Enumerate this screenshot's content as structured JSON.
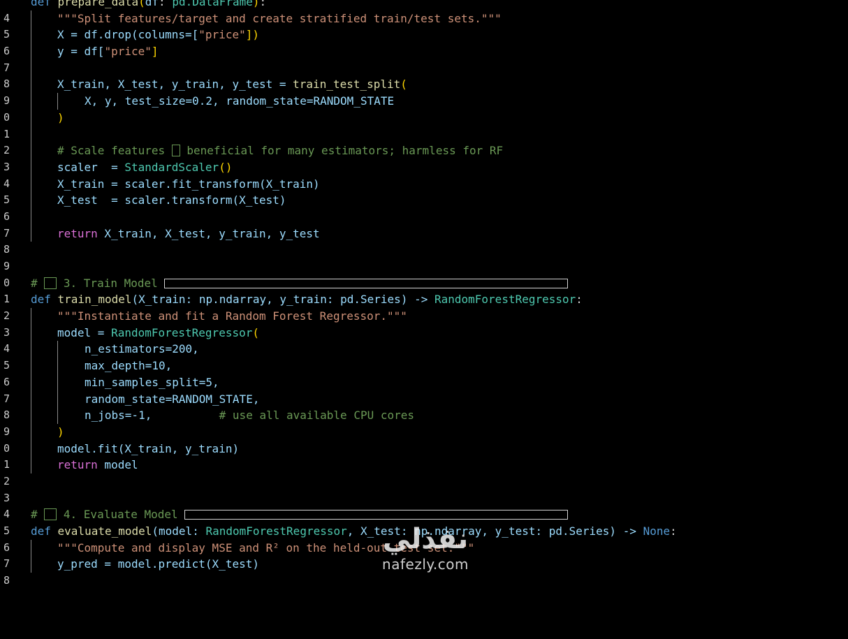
{
  "editor": {
    "line_numbers": [
      "4",
      "5",
      "6",
      "7",
      "8",
      "9",
      "0",
      "1",
      "2",
      "3",
      "4",
      "5",
      "6",
      "7",
      "8",
      "9",
      "0",
      "1",
      "2",
      "3",
      "4",
      "5",
      "6",
      "7",
      "8",
      "9",
      "0",
      "1",
      "2",
      "3",
      "4",
      "5",
      "6",
      "7",
      "8"
    ],
    "colors": {
      "background": "#000000",
      "keyword": "#569cd6",
      "function": "#dcdcaa",
      "string": "#ce9178",
      "comment": "#6a9955",
      "type": "#4ec9b0",
      "variable": "#9cdcfe",
      "number": "#b5cea8"
    },
    "code": {
      "l34": "def prepare_data(df: pd.DataFrame):",
      "l35": "\"\"\"Split features/target and create stratified train/test sets.\"\"\"",
      "l36_a": "X = df.drop(columns=[",
      "l36_b": "\"price\"",
      "l36_c": "])",
      "l37_a": "y = df[",
      "l37_b": "\"price\"",
      "l37_c": "]",
      "l39_a": "X_train, X_test, y_train, y_test = ",
      "l39_b": "train_test_split",
      "l39_c": "(",
      "l40": "X, y, test_size=0.2, random_state=RANDOM_STATE",
      "l41": ")",
      "l43_a": "# Scale features ",
      "l43_b": " beneficial for many estimators; harmless for RF",
      "l44_a": "scaler  = ",
      "l44_b": "StandardScaler",
      "l44_c": "()",
      "l45": "X_train = scaler.fit_transform(X_train)",
      "l46": "X_test  = scaler.transform(X_test)",
      "l48_a": "return",
      "l48_b": " X_train, X_test, y_train, y_test",
      "l51_a": "# ",
      "l51_b": " 3. Train Model ",
      "l52_a": "def ",
      "l52_b": "train_model",
      "l52_c": "(X_train: np.ndarray, y_train: pd.Series) -> ",
      "l52_d": "RandomForestRegressor",
      "l52_e": ":",
      "l53": "\"\"\"Instantiate and fit a Random Forest Regressor.\"\"\"",
      "l54_a": "model = ",
      "l54_b": "RandomForestRegressor",
      "l54_c": "(",
      "l55": "n_estimators=200,",
      "l56": "max_depth=10,",
      "l57": "min_samples_split=5,",
      "l58": "random_state=RANDOM_STATE,",
      "l59_a": "n_jobs=-1,",
      "l59_b": "          # use all available CPU cores",
      "l60": ")",
      "l61": "model.fit(X_train, y_train)",
      "l62_a": "return",
      "l62_b": " model",
      "l65_a": "# ",
      "l65_b": " 4. Evaluate Model ",
      "l66_a": "def ",
      "l66_b": "evaluate_model",
      "l66_c": "(model: ",
      "l66_d": "RandomForestRegressor",
      "l66_e": ", X_test: np.ndarray, y_test: pd.Series) -> ",
      "l66_f": "None",
      "l66_g": ":",
      "l67": "\"\"\"Compute and display MSE and R² on the held-out test set.\"\"\"",
      "l68": "y_pred = model.predict(X_test)"
    }
  },
  "watermark": {
    "arabic": "نفذلي",
    "latin": "nafezly.com"
  }
}
